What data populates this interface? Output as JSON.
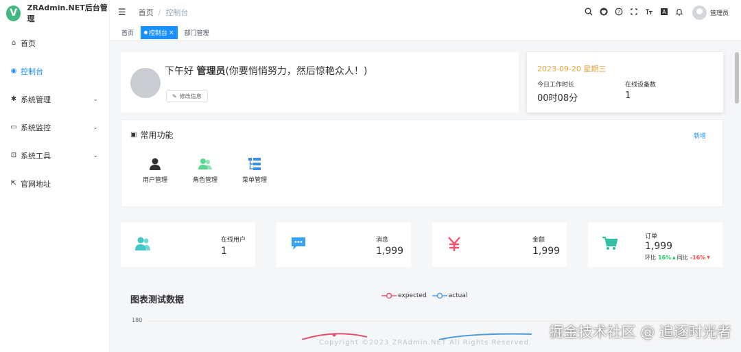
{
  "brand": {
    "logo_letter": "V",
    "name": "ZRAdmin.NET后台管理"
  },
  "sidebar": {
    "items": [
      {
        "label": "首页",
        "icon": "home-icon",
        "glyph": "⌂",
        "active": false,
        "expandable": false
      },
      {
        "label": "控制台",
        "icon": "dashboard-icon",
        "glyph": "◉",
        "active": true,
        "expandable": false
      },
      {
        "label": "系统管理",
        "icon": "gear-icon",
        "glyph": "✱",
        "active": false,
        "expandable": true
      },
      {
        "label": "系统监控",
        "icon": "monitor-icon",
        "glyph": "▭",
        "active": false,
        "expandable": true
      },
      {
        "label": "系统工具",
        "icon": "toolbox-icon",
        "glyph": "⊡",
        "active": false,
        "expandable": true
      },
      {
        "label": "官网地址",
        "icon": "external-link-icon",
        "glyph": "⇱",
        "active": false,
        "expandable": false
      }
    ]
  },
  "navbar": {
    "breadcrumb": [
      "首页",
      "控制台"
    ],
    "breadcrumb_sep": "/",
    "user": "管理员"
  },
  "tags": [
    {
      "label": "首页",
      "active": false
    },
    {
      "label": "控制台",
      "active": true
    },
    {
      "label": "部门管理",
      "active": false
    }
  ],
  "welcome": {
    "greeting_prefix": "下午好 ",
    "user": "管理员",
    "greeting_suffix": "(你要悄悄努力，然后惊艳众人！)",
    "edit_label": "修改信息"
  },
  "datecard": {
    "date": "2023-09-20 星期三",
    "work_label": "今日工作时长",
    "work_value": "00时08分",
    "device_label": "在线设备数",
    "device_value": "1"
  },
  "common": {
    "title": "常用功能",
    "add_label": "新增",
    "shortcuts": [
      {
        "label": "用户管理",
        "icon": "user-icon"
      },
      {
        "label": "角色管理",
        "icon": "role-icon"
      },
      {
        "label": "菜单管理",
        "icon": "menu-tree-icon"
      }
    ]
  },
  "stats": [
    {
      "label": "在线用户",
      "value": "1",
      "icon": "online-users-icon"
    },
    {
      "label": "消息",
      "value": "1,999",
      "icon": "message-icon"
    },
    {
      "label": "金额",
      "value": "1,999",
      "icon": "money-icon"
    },
    {
      "label": "订单",
      "value": "1,999",
      "icon": "cart-icon",
      "mom_label": "环比",
      "mom_value": "16%",
      "yoy_label": "同比",
      "yoy_value": "-16%"
    }
  ],
  "chart": {
    "title": "图表测试数据",
    "legend": [
      {
        "name": "expected",
        "color": "#e05071"
      },
      {
        "name": "actual",
        "color": "#4f9bd9"
      }
    ],
    "ytick": "180"
  },
  "footer": "Copyright ©2023 ZRAdmin.NET All Rights Reserved.",
  "watermark": "掘金技术社区 @ 追逐时光者",
  "colors": {
    "primary": "#1890ff",
    "accent_orange": "#e6a23c",
    "green": "#40c9c6",
    "red": "#f4516c"
  }
}
